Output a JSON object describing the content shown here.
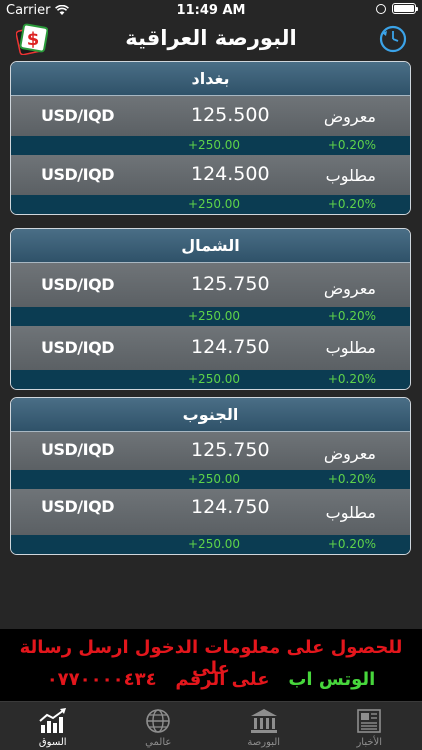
{
  "status_bar": {
    "carrier": "Carrier",
    "time": "11:49 AM"
  },
  "header": {
    "title": "البورصة العراقية"
  },
  "markets": [
    {
      "name": "بغداد",
      "rows": [
        {
          "pair": "USD/IQD",
          "price": "125.500",
          "label": "معروض",
          "change_abs": "+250.00",
          "change_pct": "+0.20%"
        },
        {
          "pair": "USD/IQD",
          "price": "124.500",
          "label": "مطلوب",
          "change_abs": "+250.00",
          "change_pct": "+0.20%"
        }
      ]
    },
    {
      "name": "الشمال",
      "rows": [
        {
          "pair": "USD/IQD",
          "price": "125.750",
          "label": "معروض",
          "change_abs": "+250.00",
          "change_pct": "+0.20%"
        },
        {
          "pair": "USD/IQD",
          "price": "124.750",
          "label": "مطلوب",
          "change_abs": "+250.00",
          "change_pct": "+0.20%"
        }
      ]
    },
    {
      "name": "الجنوب",
      "rows": [
        {
          "pair": "USD/IQD",
          "price": "125.750",
          "label": "معروض",
          "change_abs": "+250.00",
          "change_pct": "+0.20%"
        },
        {
          "pair": "USD/IQD",
          "price": "124.750",
          "label": "مطلوب",
          "change_abs": "+250.00",
          "change_pct": "+0.20%"
        }
      ]
    }
  ],
  "banner": {
    "line1": "للحصول على معلومات الدخول ارسل رسالة على",
    "line2_whatsapp": "الوتس اب",
    "line2_number_label": "على الرقم",
    "line2_number": "٠٧٧٠٠٠٠٤٣٤"
  },
  "tabs": [
    {
      "label": "السوق",
      "icon": "chart-icon",
      "active": true
    },
    {
      "label": "عالمي",
      "icon": "globe-icon",
      "active": false
    },
    {
      "label": "البورصة",
      "icon": "bank-icon",
      "active": false
    },
    {
      "label": "الأخبار",
      "icon": "newspaper-icon",
      "active": false
    }
  ],
  "colors": {
    "background": "#262626",
    "card_header": "#3d6178",
    "change_row": "#0b3c52",
    "positive": "#5ed24a",
    "banner_red": "#e3161c",
    "banner_green": "#47d63c"
  }
}
